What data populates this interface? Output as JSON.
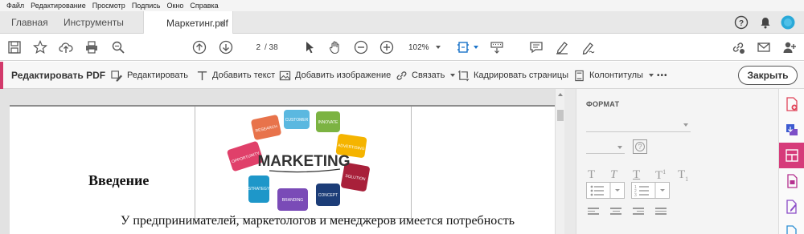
{
  "menu": [
    "Файл",
    "Редактирование",
    "Просмотр",
    "Подпись",
    "Окно",
    "Справка"
  ],
  "tabs": {
    "home": "Главная",
    "tools": "Инструменты",
    "document": "Маркетинг.pdf",
    "close_glyph": "×"
  },
  "toolbar": {
    "page_current": "2",
    "page_total": "/ 38",
    "zoom": "102%"
  },
  "editbar": {
    "title": "Редактировать PDF",
    "edit": "Редактировать",
    "add_text": "Добавить текст",
    "add_image": "Добавить изображение",
    "link": "Связать",
    "crop": "Кадрировать страницы",
    "header_footer": "Колонтитулы",
    "more": "•••",
    "close": "Закрыть"
  },
  "document": {
    "heading": "Введение",
    "body_line": "У предпринимателей, маркетологов и менеджеров имеется потребность",
    "image": {
      "title": "MARKETING",
      "bubbles": [
        "RESEARCH",
        "CUSTOMER",
        "INNOVATE",
        "ADVERTISING",
        "OPPORTUNITY",
        "SOLUTION",
        "STRATEGY",
        "BRANDING",
        "CONCEPT"
      ]
    }
  },
  "format_panel": {
    "title": "ФОРМАТ",
    "help_glyph": "?"
  },
  "colors": {
    "accent": "#d23a6b",
    "rail_active": "#d63b7a",
    "toolbar_blue": "#1a73c9"
  }
}
